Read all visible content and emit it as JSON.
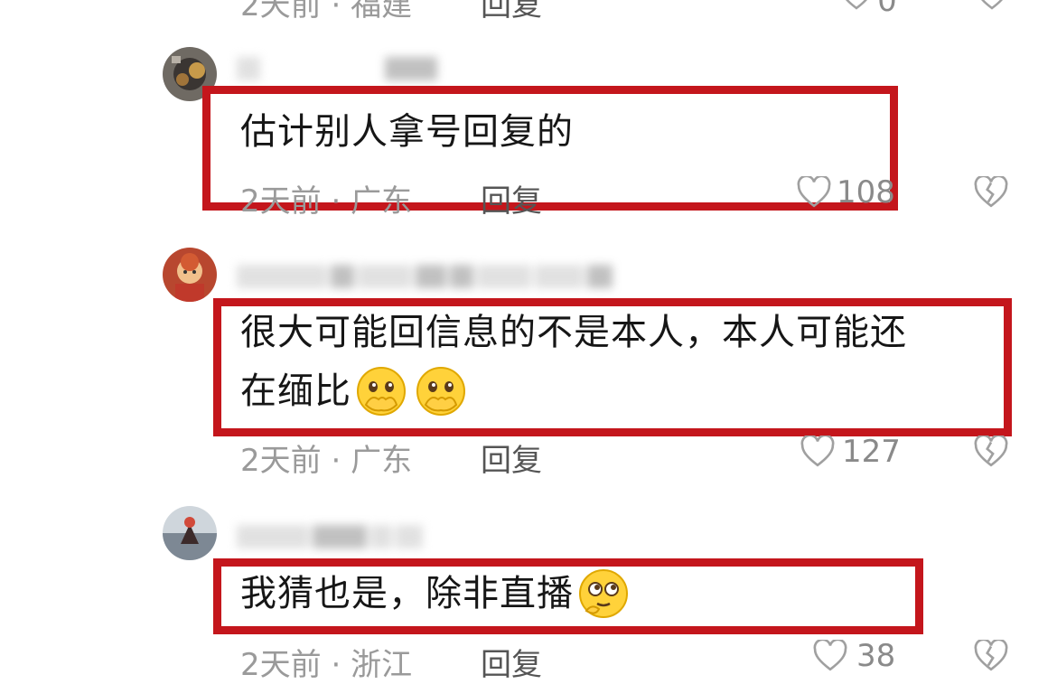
{
  "comments": [
    {
      "time": "2天前",
      "location": "福建",
      "reply_label": "回复",
      "likes": "0"
    },
    {
      "text": "估计别人拿号回复的",
      "time": "2天前",
      "location": "广东",
      "reply_label": "回复",
      "likes": "108"
    },
    {
      "text_line1": "很大可能回信息的不是本人，本人可能还",
      "text_line2": "在缅比",
      "time": "2天前",
      "location": "广东",
      "reply_label": "回复",
      "likes": "127",
      "emojis": [
        "hand-over-mouth-emoji",
        "hand-over-mouth-emoji"
      ]
    },
    {
      "text": "我猜也是，除非直播",
      "time": "2天前",
      "location": "浙江",
      "reply_label": "回复",
      "likes": "38",
      "emojis": [
        "thinking-eyes-emoji"
      ]
    }
  ],
  "meta_separator": "·",
  "colors": {
    "highlight_frame": "#c4161c",
    "meta_text": "#9a9a9a",
    "body_text": "#161616"
  },
  "icons": [
    "heart-outline-icon",
    "broken-heart-icon"
  ]
}
